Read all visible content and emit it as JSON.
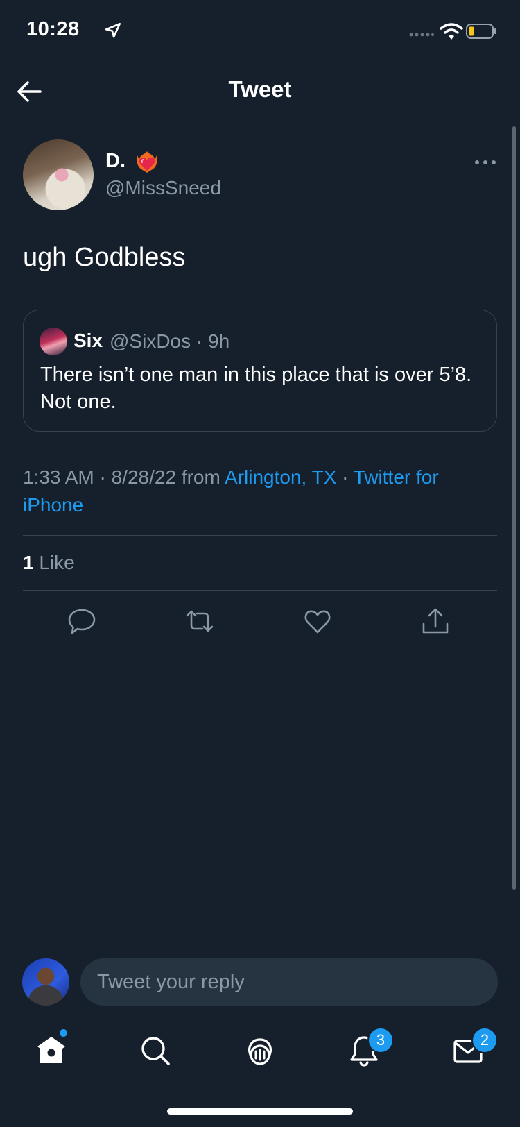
{
  "status_bar": {
    "time": "10:28"
  },
  "header": {
    "title": "Tweet"
  },
  "tweet": {
    "author_name": "D.",
    "author_handle": "@MissSneed",
    "text": "ugh Godbless",
    "timestamp": "1:33 AM · 8/28/22 from ",
    "location": "Arlington, TX",
    "separator": " · ",
    "source": "Twitter for iPhone",
    "like_count": "1",
    "like_label": "Like"
  },
  "quoted_tweet": {
    "author_name": "Six",
    "handle_time": "@SixDos · 9h",
    "text": "There isn’t one man in this place that is over 5’8. Not one."
  },
  "reply": {
    "placeholder": "Tweet your reply"
  },
  "tab_bar": {
    "notifications_badge": "3",
    "messages_badge": "2"
  },
  "colors": {
    "background": "#16202c",
    "accent": "#1d9bf0",
    "secondary_text": "#8b98a5",
    "border": "#38444d"
  }
}
